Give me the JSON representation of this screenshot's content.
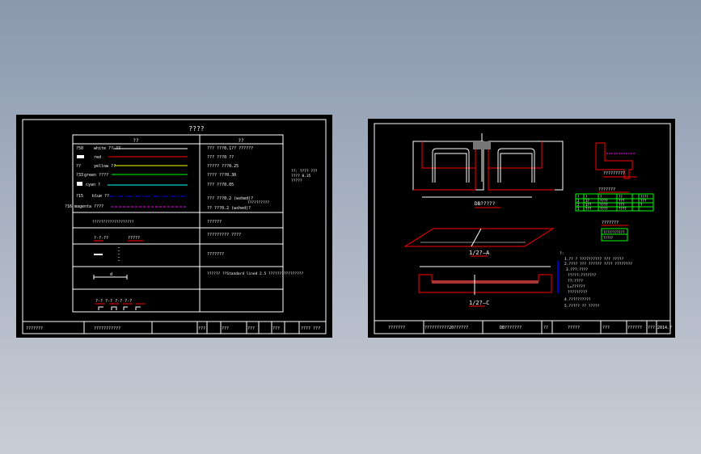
{
  "left_sheet": {
    "title": "????",
    "header": [
      "??",
      "??"
    ],
    "legend": [
      {
        "code": "?50",
        "name": "white ??-??",
        "color": "#ffffff",
        "desc": "??? ???0.1?? ??????"
      },
      {
        "code": "",
        "name": "red",
        "color": "#ff0000",
        "desc": "??? ???0 ??"
      },
      {
        "code": "??",
        "name": "yellow ??",
        "color": "#ffff00",
        "desc": "????? ???0.25"
      },
      {
        "code": "?33",
        "name": "green ????",
        "color": "#00ff00",
        "desc": "???? ???0.30"
      },
      {
        "code": "",
        "name": "cyan ?",
        "color": "#00ffff",
        "desc": "??? ???0.05"
      },
      {
        "code": "?15",
        "name": "blue ??",
        "color": "#0000ff",
        "desc": "??? ???0.2 (wshed)?"
      },
      {
        "code": "?16",
        "name": "magenta ????",
        "color": "#ff00ff",
        "desc": "?? ???0.2 (wshed)?"
      }
    ],
    "side_note": [
      "??: ???? ???",
      "???? 0.35",
      "?????"
    ],
    "bracket_note": "??????????",
    "rows": [
      {
        "left": "???????????????????",
        "right": "??????"
      },
      {
        "left_a": "?-?-??",
        "left_b": "?????",
        "right": "?????????\n????"
      },
      {
        "left": "",
        "right": "???????"
      },
      {
        "left": "d",
        "right": "??????\n??Standard lined 2.5\n????????????????"
      },
      {
        "left": "?-? ?-? ?-? ?-?",
        "right": ""
      }
    ],
    "title_block": [
      "???????",
      "???????????",
      "???",
      "???",
      "???",
      "???",
      "???? ???"
    ]
  },
  "right_sheet": {
    "section_label": "DB?????",
    "view_a": "1/2?—A",
    "view_c": "1/2?—C",
    "detail_title": "?????????",
    "table_title": "???????",
    "table_rows": [
      [
        "?",
        "?",
        "?",
        "??",
        "?",
        "?",
        "????"
      ],
      [
        "1",
        "1?",
        "????",
        "???",
        "???",
        "1",
        "???"
      ],
      [
        "2",
        "1??",
        "????",
        "???",
        "???",
        "1",
        "?"
      ],
      [
        "3",
        "???",
        "????",
        "???",
        "????",
        "",
        ""
      ]
    ],
    "box_title": "???????",
    "box_lines": [
      "???????????",
      "?????"
    ],
    "notes_title": "?:",
    "notes": [
      "1.?? ? ?????????? ??? ?????",
      "2.???? ??? ?????? ???? ????????",
      "3.???:????",
      "?????:???????",
      "??:????",
      "L=??????",
      "?????????",
      "4.??????????",
      "5.????? ?? ?????"
    ],
    "title_block": [
      "???????",
      "??????????20??????",
      "DB???????",
      "??",
      "?????",
      "???",
      "??????",
      "????",
      "???",
      "2014.?"
    ]
  }
}
